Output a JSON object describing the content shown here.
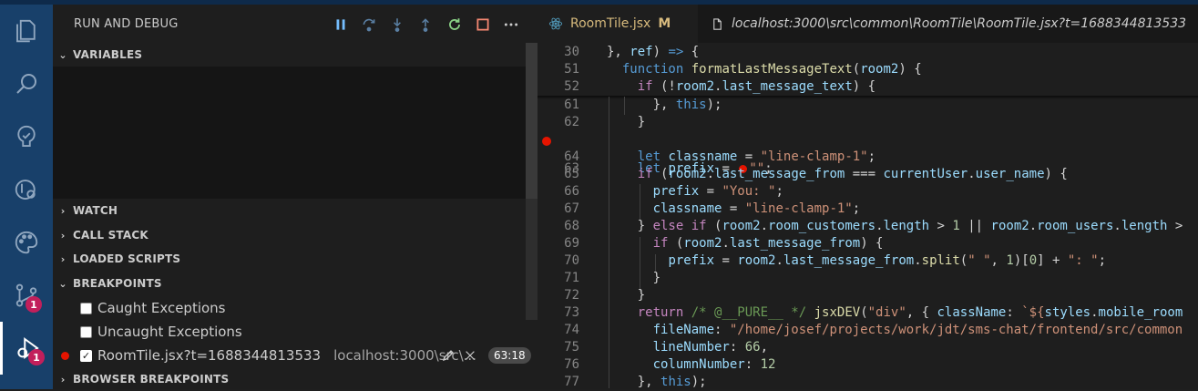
{
  "activity_bar": {
    "items": [
      {
        "icon": "files-icon",
        "badge": ""
      },
      {
        "icon": "search-icon",
        "badge": ""
      },
      {
        "icon": "testing-icon",
        "badge": ""
      },
      {
        "icon": "remote-explorer-icon",
        "badge": ""
      },
      {
        "icon": "palette-icon",
        "badge": ""
      },
      {
        "icon": "source-control-icon",
        "badge": "1"
      },
      {
        "icon": "run-debug-icon",
        "badge": "1"
      }
    ]
  },
  "sidebar": {
    "title": "RUN AND DEBUG",
    "toolbar": [
      "pause-icon",
      "step-over-icon",
      "step-into-icon",
      "step-out-icon",
      "restart-icon",
      "stop-icon",
      "more-icon"
    ],
    "sections": {
      "variables": "VARIABLES",
      "watch": "WATCH",
      "call_stack": "CALL STACK",
      "loaded_scripts": "LOADED SCRIPTS",
      "breakpoints": "BREAKPOINTS",
      "browser_breakpoints": "BROWSER BREAKPOINTS"
    },
    "breakpoints": {
      "caught": {
        "label": "Caught Exceptions",
        "checked": false
      },
      "uncaught": {
        "label": "Uncaught Exceptions",
        "checked": false
      },
      "file": {
        "label": "RoomTile.jsx?t=1688344813533",
        "path": "localhost:3000\\src\\...",
        "line": "63:18",
        "checked": true
      }
    }
  },
  "editor": {
    "tabs": [
      {
        "label": "RoomTile.jsx",
        "modified": "M",
        "active": true
      },
      {
        "label": "localhost:3000\\src\\common\\RoomTile\\RoomTile.jsx?t=1688344813533",
        "modified": "",
        "active": false
      }
    ],
    "lines": [
      {
        "num": "30",
        "text": "  }, ref) => {"
      },
      {
        "num": "51",
        "text": "    function formatLastMessageText(room2) {"
      },
      {
        "num": "52",
        "text": "      if (!room2.last_message_text) {"
      },
      {
        "num": "61",
        "text": "      }, this);"
      },
      {
        "num": "62",
        "text": "      }"
      },
      {
        "num": "63",
        "text": "      let prefix = \"\";",
        "breakpoint": true
      },
      {
        "num": "64",
        "text": "      let classname = \"line-clamp-1\";"
      },
      {
        "num": "65",
        "text": "      if (room2.last_message_from === currentUser.user_name) {"
      },
      {
        "num": "66",
        "text": "        prefix = \"You: \";"
      },
      {
        "num": "67",
        "text": "        classname = \"line-clamp-1\";"
      },
      {
        "num": "68",
        "text": "      } else if (room2.room_customers.length > 1 || room2.room_users.length >"
      },
      {
        "num": "69",
        "text": "        if (room2.last_message_from) {"
      },
      {
        "num": "70",
        "text": "          prefix = room2.last_message_from.split(\" \", 1)[0] + \": \";"
      },
      {
        "num": "71",
        "text": "        }"
      },
      {
        "num": "72",
        "text": "      }"
      },
      {
        "num": "73",
        "text": "      return /* @__PURE__ */ jsxDEV(\"div\", { className: `${styles.mobile_room"
      },
      {
        "num": "74",
        "text": "        fileName: \"/home/josef/projects/work/jdt/sms-chat/frontend/src/common"
      },
      {
        "num": "75",
        "text": "        lineNumber: 66,"
      },
      {
        "num": "76",
        "text": "        columnNumber: 12"
      },
      {
        "num": "77",
        "text": "      }, this);"
      }
    ]
  },
  "colors": {
    "activity_bg": "#18406a",
    "badge": "#c21f5b",
    "breakpoint": "#e51400",
    "modified": "#d7ba7d"
  }
}
